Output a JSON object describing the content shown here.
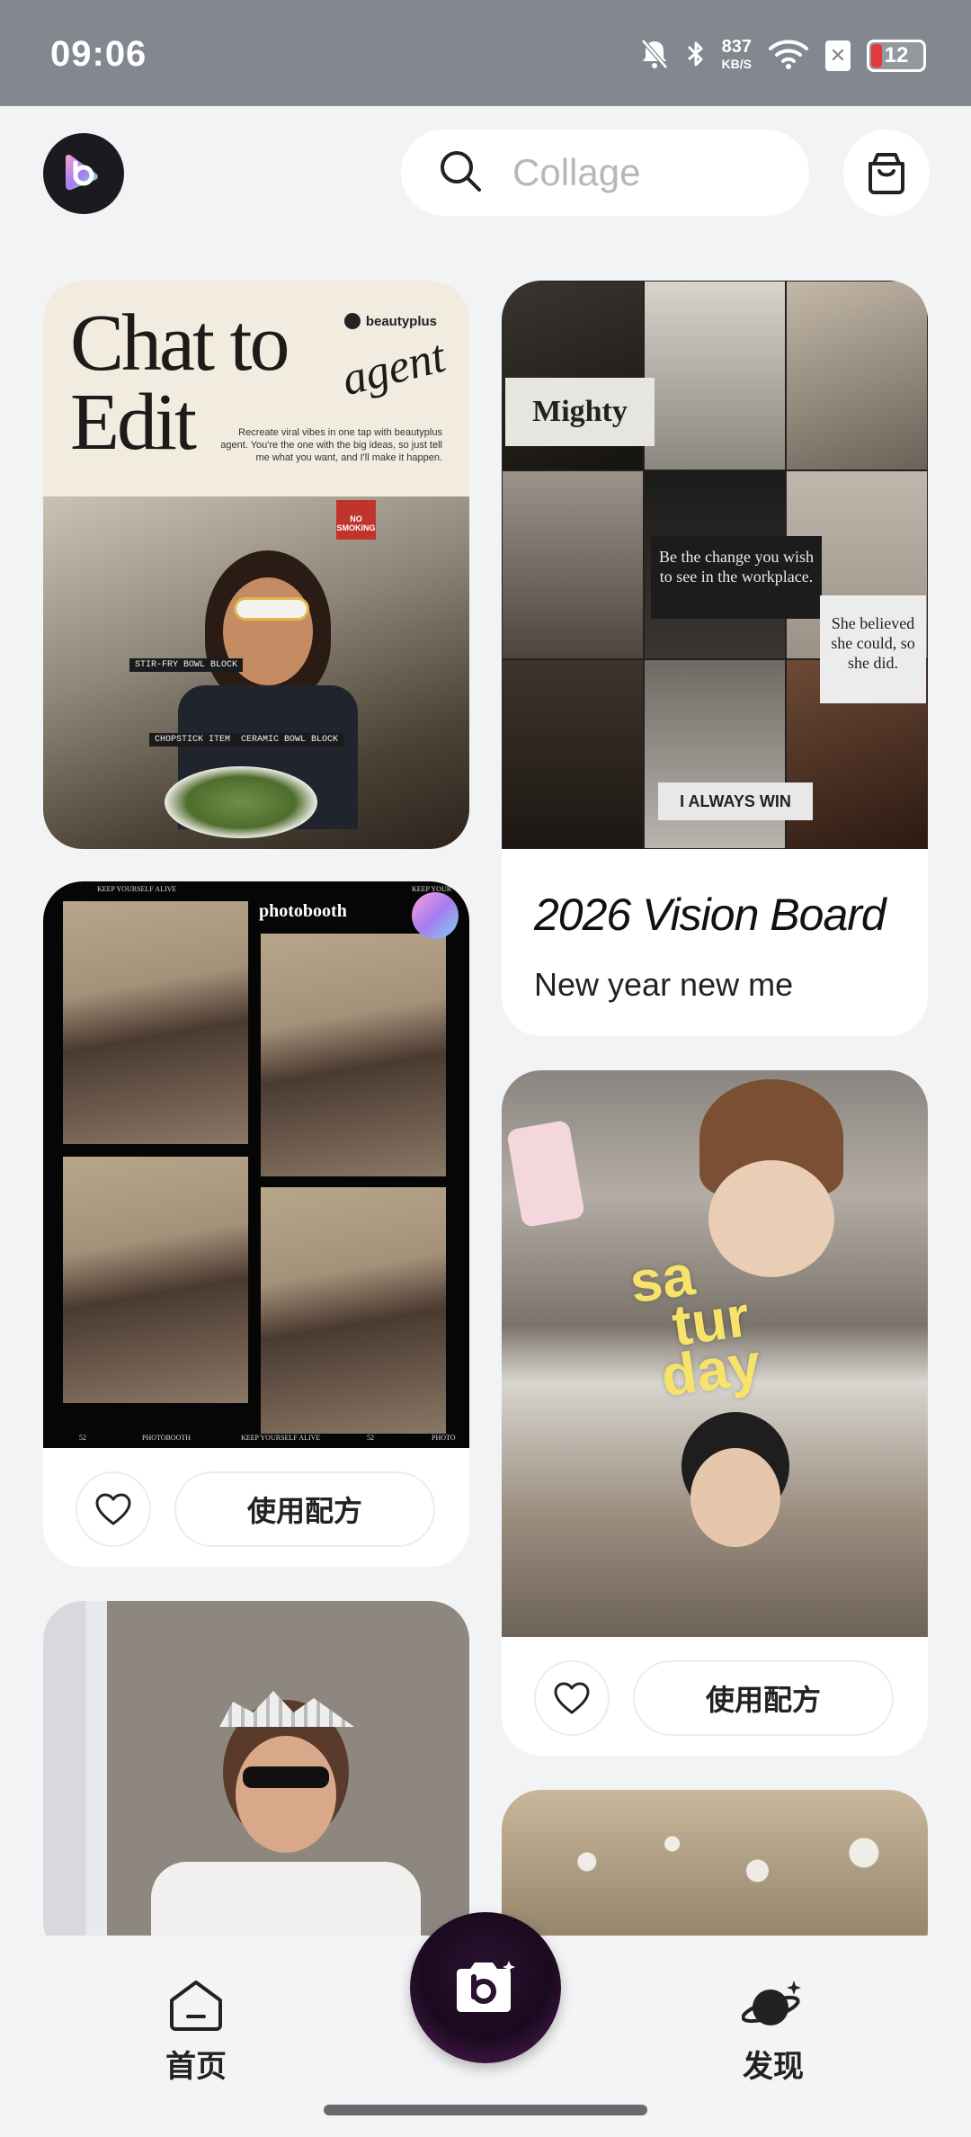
{
  "status_bar": {
    "time": "09:06",
    "net_speed_value": "837",
    "net_speed_unit": "KB/S",
    "battery": "12",
    "icons": [
      "mute-icon",
      "bluetooth-icon",
      "wifi-icon",
      "no-sim-icon",
      "battery-icon"
    ]
  },
  "header": {
    "search_placeholder": "Collage",
    "icons": [
      "app-logo-icon",
      "search-icon",
      "shopping-bag-icon"
    ]
  },
  "feed": {
    "card1": {
      "title_line1": "Chat to",
      "title_line2": "Edit",
      "brand": "beautyplus",
      "accent": "agent",
      "description": "Recreate viral vibes in one tap with beautyplus agent. You're the one with the big ideas, so just tell me what you want, and I'll make it happen.",
      "tag1": "STIR-FRY BOWL BLOCK",
      "tag2": "CHOPSTICK ITEM",
      "tag3": "CERAMIC BOWL BLOCK",
      "sign": "NO SMOKING"
    },
    "card2": {
      "mighty": "Mighty",
      "quote1": "Be the change you wish to see in the workplace.",
      "quote2": "She believed she could, so she did.",
      "quote3": "I ALWAYS WIN",
      "title": "2026 Vision Board",
      "subtitle": "New year new me"
    },
    "card3": {
      "label": "photobooth",
      "strip_top": "KEEP YOURSELF ALIVE",
      "strip_top2": "KEEP YOUR",
      "strip_bottom1": "52",
      "strip_bottom2": "PHOTOBOOTH",
      "strip_bottom3": "KEEP YOURSELF ALIVE",
      "strip_bottom4": "52",
      "strip_bottom5": "PHOTO",
      "use_recipe": "使用配方"
    },
    "card4": {
      "word1": "sa",
      "word2": "tur",
      "word3": "day",
      "use_recipe": "使用配方"
    }
  },
  "bottom_nav": {
    "home": "首页",
    "discover": "发现"
  }
}
